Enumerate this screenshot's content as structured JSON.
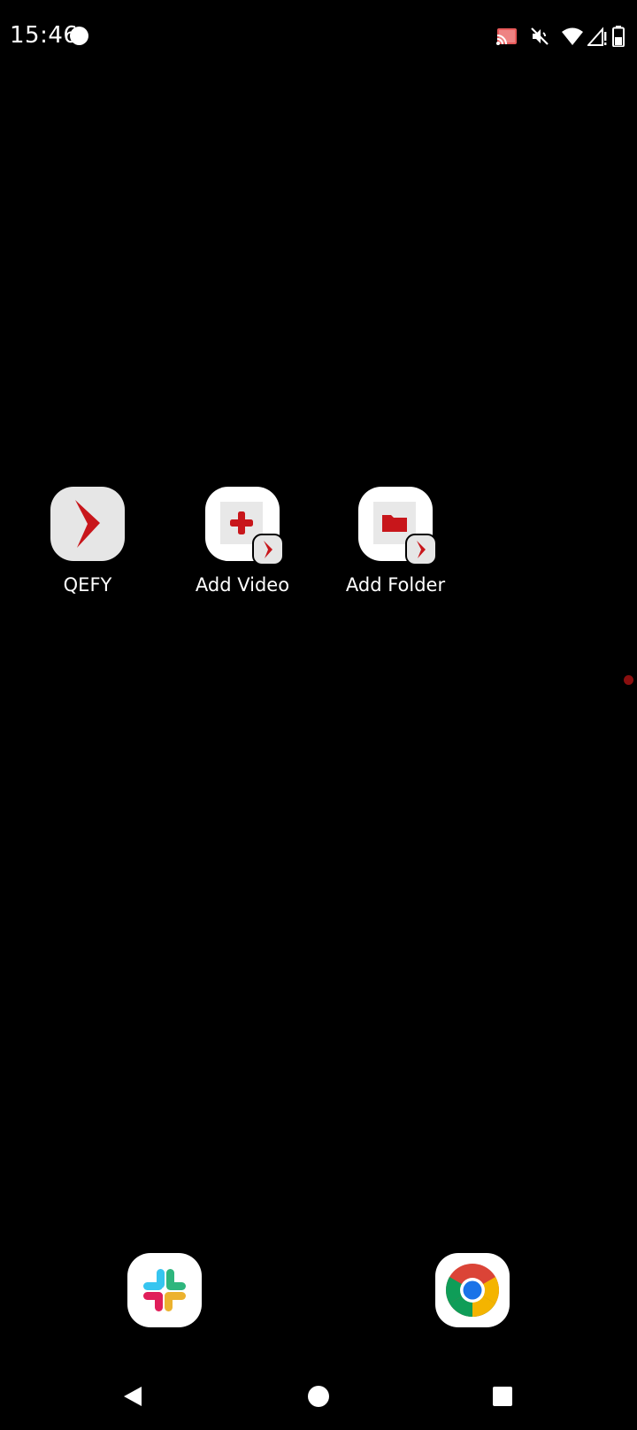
{
  "status_bar": {
    "time": "15:46",
    "icons": [
      "notification-dot-icon",
      "cast-icon",
      "vibrate-mute-icon",
      "wifi-icon",
      "signal-no-sim-icon",
      "battery-icon"
    ]
  },
  "shortcuts": [
    {
      "label": "QEFY",
      "icon": "qefy-app-icon"
    },
    {
      "label": "Add Video",
      "icon": "add-video-shortcut-icon"
    },
    {
      "label": "Add Folder",
      "icon": "add-folder-shortcut-icon"
    }
  ],
  "dock": {
    "apps": [
      {
        "icon": "slack-icon"
      },
      {
        "icon": "chrome-icon"
      }
    ]
  },
  "nav_bar": {
    "buttons": [
      "back-icon",
      "home-icon",
      "recents-icon"
    ]
  },
  "colors": {
    "background": "#000000",
    "qefy_red": "#c8161b",
    "tile_gray": "#e6e6e6"
  }
}
